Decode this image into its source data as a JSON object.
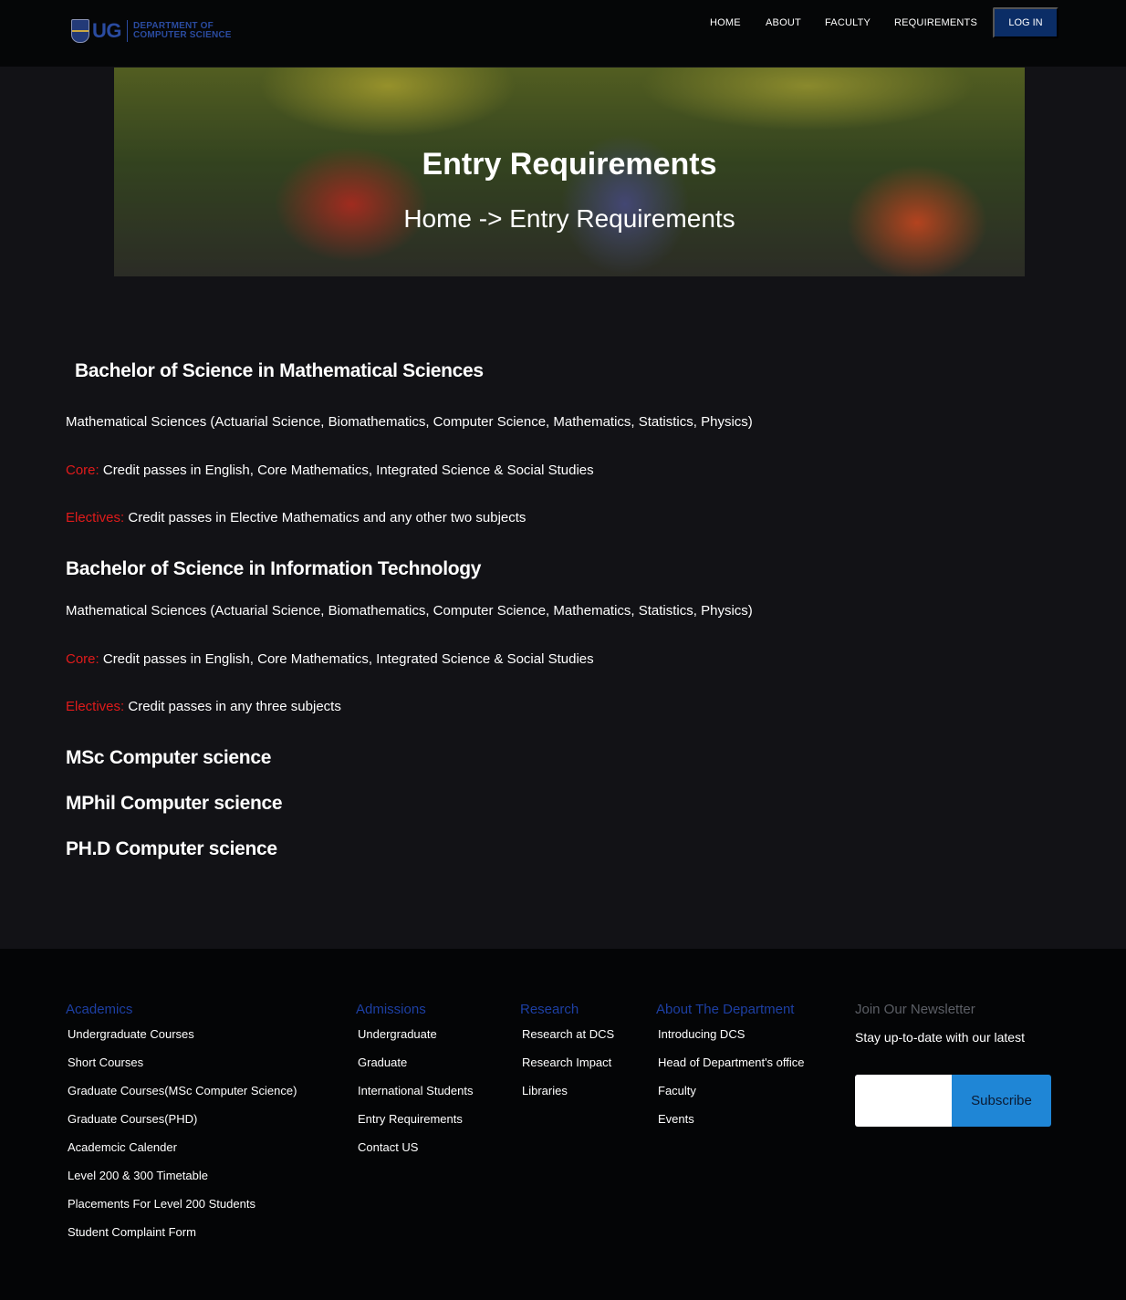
{
  "header": {
    "logo_ug": "UG",
    "logo_dept_line1": "DEPARTMENT OF",
    "logo_dept_line2": "COMPUTER SCIENCE",
    "nav": [
      "HOME",
      "ABOUT",
      "FACULTY",
      "REQUIREMENTS"
    ],
    "login_label": "LOG IN"
  },
  "hero": {
    "title": "Entry Requirements",
    "breadcrumb": "Home -> Entry Requirements"
  },
  "programs": [
    {
      "title": "Bachelor of Science in Mathematical Sciences",
      "description": "Mathematical Sciences (Actuarial Science, Biomathematics, Computer Science, Mathematics, Statistics, Physics)",
      "core_label": "Core:",
      "core_text": "Credit passes in English, Core Mathematics, Integrated Science & Social Studies",
      "electives_label": "Electives:",
      "electives_text": "Credit passes in Elective Mathematics and any other two subjects"
    },
    {
      "title": "Bachelor of Science in Information Technology",
      "description": "Mathematical Sciences (Actuarial Science, Biomathematics, Computer Science, Mathematics, Statistics, Physics)",
      "core_label": "Core:",
      "core_text": "Credit passes in English, Core Mathematics, Integrated Science & Social Studies",
      "electives_label": "Electives:",
      "electives_text": "Credit passes in any three subjects"
    }
  ],
  "postgrad": [
    "MSc Computer science",
    "MPhil Computer science",
    "PH.D Computer science"
  ],
  "footer": {
    "academics": {
      "heading": "Academics",
      "items": [
        "Undergraduate Courses",
        "Short Courses",
        "Graduate Courses(MSc Computer Science)",
        "Graduate Courses(PHD)",
        "Academcic Calender",
        "Level 200 & 300 Timetable",
        "Placements For Level 200 Students",
        "Student Complaint Form"
      ]
    },
    "admissions": {
      "heading": "Admissions",
      "items": [
        "Undergraduate",
        "Graduate",
        "International Students",
        "Entry Requirements",
        "Contact US"
      ]
    },
    "research": {
      "heading": "Research",
      "items": [
        "Research at DCS",
        "Research Impact",
        "Libraries"
      ]
    },
    "about": {
      "heading": "About The Department",
      "items": [
        "Introducing DCS",
        "Head of Department's office",
        "Faculty",
        "Events"
      ]
    },
    "newsletter": {
      "heading": "Join Our Newsletter",
      "text": "Stay up-to-date with our latest",
      "input_value": "",
      "button_label": "Subscribe"
    }
  },
  "colors": {
    "background": "#121216",
    "header_bg": "#050607",
    "login_bg": "#0b2d66",
    "accent_red": "#e01b1b",
    "footer_heading": "#1d3fa3",
    "subscribe_bg": "#1f86d6"
  }
}
